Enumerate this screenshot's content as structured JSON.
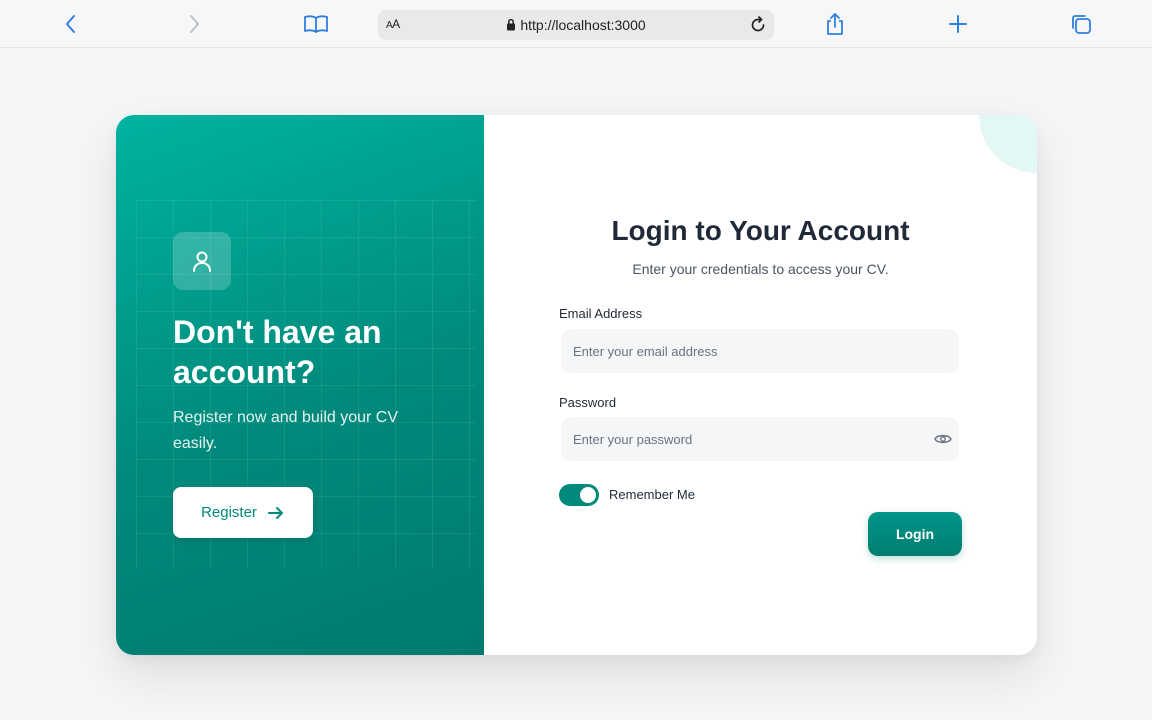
{
  "browser": {
    "reader_label_small": "A",
    "reader_label_large": "A",
    "url": "http://localhost:3000",
    "icon_color": "#2f7fe0"
  },
  "left_panel": {
    "icon": "user-icon",
    "title": "Don't have an account?",
    "subtitle": "Register now and build your CV easily.",
    "register_label": "Register",
    "register_icon": "arrow-right-icon"
  },
  "login": {
    "title": "Login to Your Account",
    "subtitle": "Enter your credentials to access your CV.",
    "email_label": "Email Address",
    "email_placeholder": "Enter your email address",
    "email_value": "",
    "password_label": "Password",
    "password_placeholder": "Enter your password",
    "password_value": "",
    "password_visibility_icon": "eye-icon",
    "remember_label": "Remember Me",
    "remember_checked": true,
    "submit_label": "Login"
  },
  "colors": {
    "accent": "#00897b",
    "accent_light": "#00b3a0",
    "page_background": "#f5f6f8"
  }
}
